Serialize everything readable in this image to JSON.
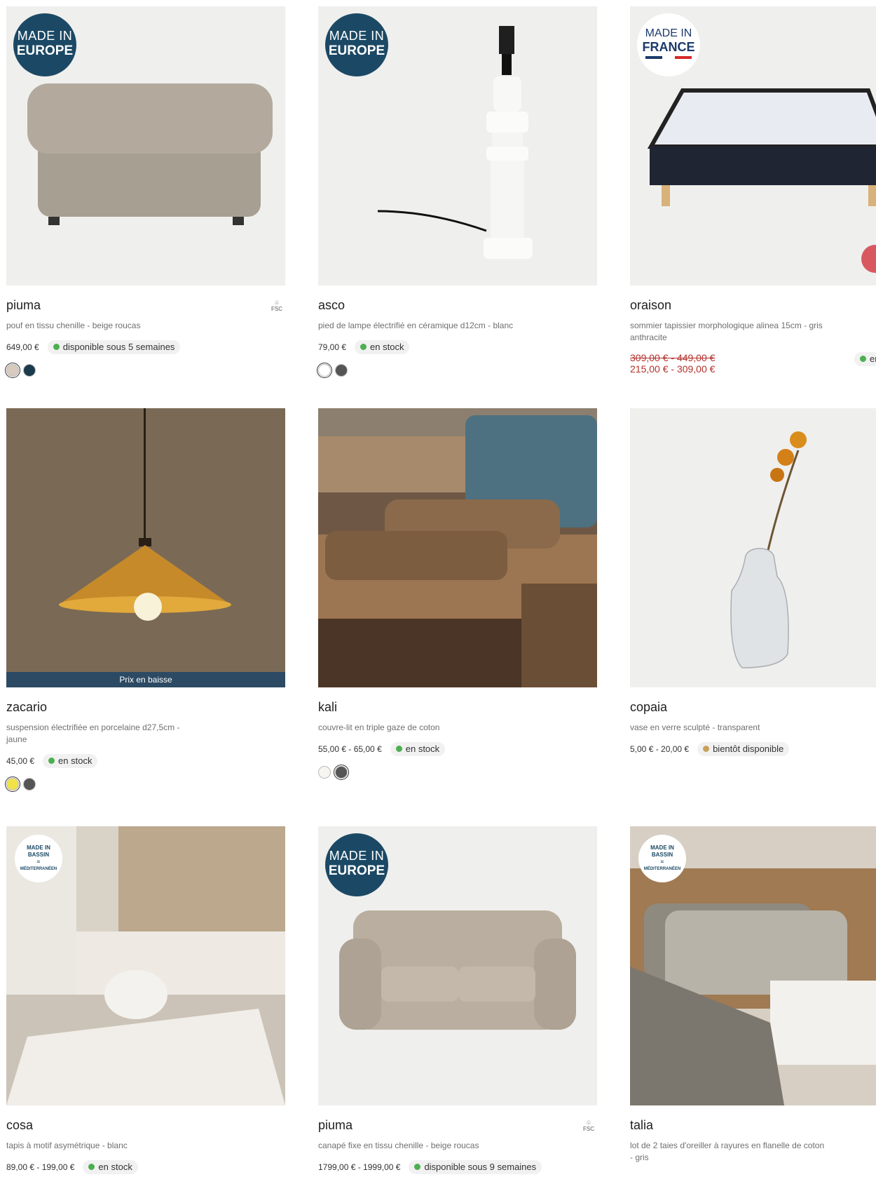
{
  "products": [
    {
      "name": "piuma",
      "desc": "pouf en tissu chenille - beige roucas",
      "price": "649,00 €",
      "availability": "disponible sous 5 semaines",
      "label": "made-europe",
      "fsc": "FSC",
      "swatches": [
        "#d8cbbd",
        "#1b3a4b"
      ]
    },
    {
      "name": "asco",
      "desc": "pied de lampe électrifié en céramique d12cm - blanc",
      "price": "79,00 €",
      "availability": "en stock",
      "label": "made-europe",
      "swatches": [
        "#ffffff",
        "#555555"
      ]
    },
    {
      "name": "oraison",
      "desc": "sommier tapissier morphologique alinea 15cm - gris anthracite",
      "old_price": "309,00 € - 449,00 €",
      "new_price": "215,00 € - 309,00 €",
      "availability": "en",
      "label": "made-france"
    },
    {
      "name": "zacario",
      "desc": "suspension électrifiée en porcelaine d27,5cm - jaune",
      "price": "45,00 €",
      "availability": "en stock",
      "banner": "Prix en baisse",
      "swatches": [
        "#f2e24a",
        "#555555"
      ]
    },
    {
      "name": "kali",
      "desc": "couvre-lit en triple gaze de coton",
      "price": "55,00 € - 65,00 €",
      "availability": "en stock",
      "swatches": [
        "#f7f5ef",
        "#555555"
      ]
    },
    {
      "name": "copaia",
      "desc": "vase en verre sculpté - transparent",
      "price": "5,00 € - 20,00 €",
      "availability": "bientôt disponible",
      "availability_color": "amber"
    },
    {
      "name": "cosa",
      "desc": "tapis à motif asymétrique - blanc",
      "price": "89,00 € - 199,00 €",
      "availability": "en stock",
      "label": "made-med"
    },
    {
      "name": "piuma",
      "desc": "canapé fixe en tissu chenille - beige roucas",
      "price": "1799,00 € - 1999,00 €",
      "availability": "disponible sous 9 semaines",
      "label": "made-europe",
      "fsc": "FSC"
    },
    {
      "name": "talia",
      "desc": "lot de 2 taies d'oreiller à rayures en flanelle de coton - gris",
      "label": "made-med"
    }
  ],
  "labels": {
    "europe_l1": "MADE IN",
    "europe_l2": "EUROPE",
    "france_l1": "MADE IN",
    "france_l2": "FRANCE",
    "med_l1": "MADE IN",
    "med_l2": "BASSIN",
    "med_l3": "MÉDITERRANÉEN"
  },
  "colors": {
    "navy": "#1b4965",
    "sale": "#b3312b",
    "stock": "#4caf50"
  }
}
